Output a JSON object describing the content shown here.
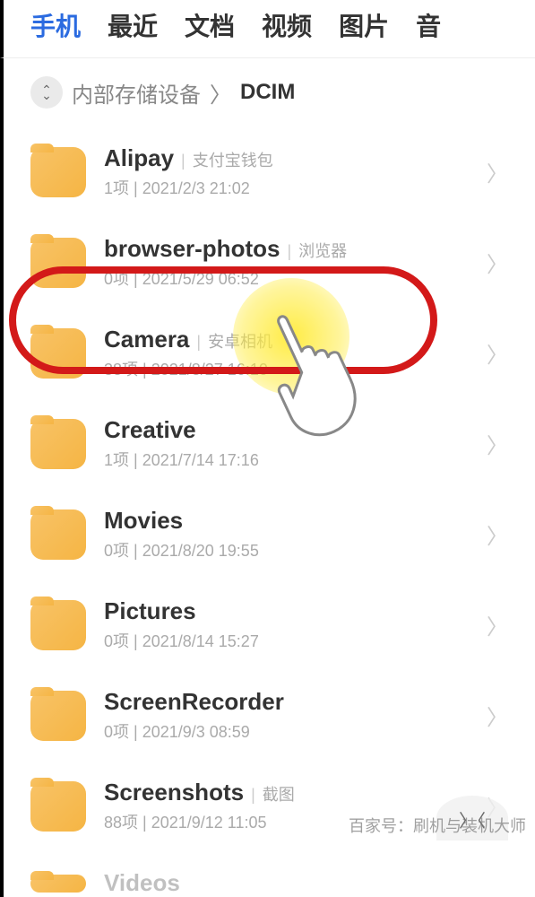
{
  "tabs": {
    "items": [
      {
        "label": "手机",
        "active": true
      },
      {
        "label": "最近",
        "active": false
      },
      {
        "label": "文档",
        "active": false
      },
      {
        "label": "视频",
        "active": false
      },
      {
        "label": "图片",
        "active": false
      },
      {
        "label": "音",
        "active": false
      }
    ]
  },
  "breadcrumb": {
    "parent": "内部存储设备",
    "separator": "〉",
    "current": "DCIM"
  },
  "files": [
    {
      "name": "Alipay",
      "desc": "支付宝钱包",
      "count": "1项",
      "date": "2021/2/3 21:02"
    },
    {
      "name": "browser-photos",
      "desc": "浏览器",
      "count": "0项",
      "date": "2021/5/29 06:52"
    },
    {
      "name": "Camera",
      "desc": "安卓相机",
      "count": "38项",
      "date": "2021/8/27 16:10"
    },
    {
      "name": "Creative",
      "desc": "",
      "count": "1项",
      "date": "2021/7/14 17:16"
    },
    {
      "name": "Movies",
      "desc": "",
      "count": "0项",
      "date": "2021/8/20 19:55"
    },
    {
      "name": "Pictures",
      "desc": "",
      "count": "0项",
      "date": "2021/8/14 15:27"
    },
    {
      "name": "ScreenRecorder",
      "desc": "",
      "count": "0项",
      "date": "2021/9/3 08:59"
    },
    {
      "name": "Screenshots",
      "desc": "截图",
      "count": "88项",
      "date": "2021/9/12 11:05"
    },
    {
      "name": "Videos",
      "desc": "",
      "count": "",
      "date": ""
    }
  ],
  "watermark": "百家号：刷机与装机大师",
  "meta_separator": "  |  "
}
